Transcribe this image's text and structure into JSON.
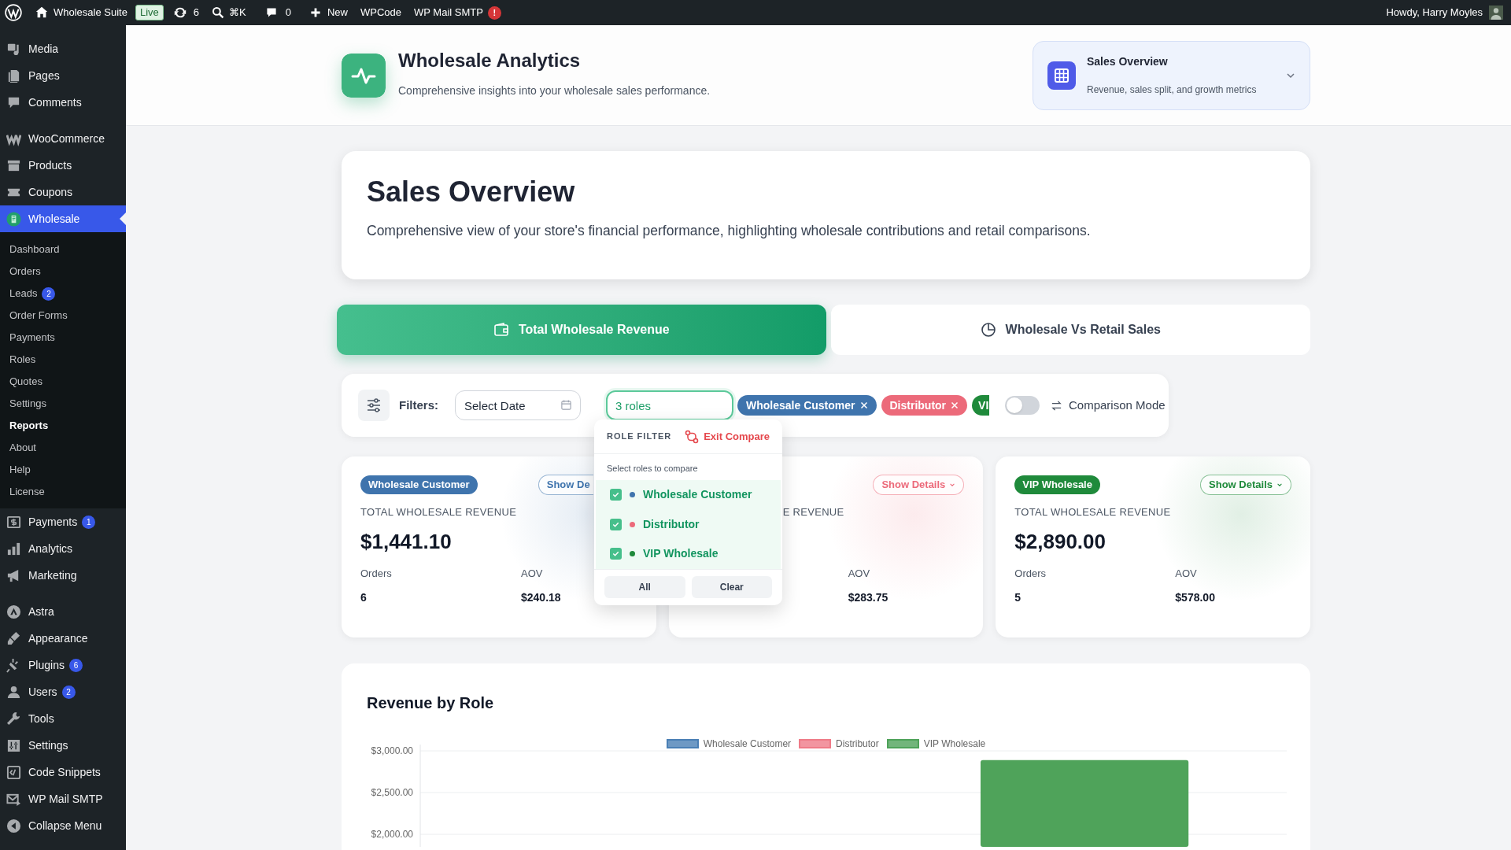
{
  "admin_bar": {
    "site": "Wholesale Suite",
    "live": "Live",
    "updates": "6",
    "search": "⌘K",
    "comments": "0",
    "new": "New",
    "links": [
      "WPCode",
      "WP Mail SMTP"
    ],
    "alert": "!",
    "greeting": "Howdy, Harry Moyles"
  },
  "sidebar": {
    "sections": [
      [
        {
          "label": "Media",
          "selected": false
        },
        {
          "label": "Pages",
          "selected": false
        },
        {
          "label": "Comments",
          "selected": false
        }
      ],
      [
        {
          "label": "WooCommerce",
          "selected": false
        },
        {
          "label": "Products",
          "selected": false
        },
        {
          "label": "Coupons",
          "selected": false
        },
        {
          "label": "Wholesale",
          "selected": true,
          "children": [
            {
              "label": "Dashboard",
              "selected": false
            },
            {
              "label": "Orders",
              "selected": false
            },
            {
              "label": "Leads",
              "selected": false,
              "badge": "2"
            },
            {
              "label": "Order Forms",
              "selected": false
            },
            {
              "label": "Payments",
              "selected": false
            },
            {
              "label": "Roles",
              "selected": false
            },
            {
              "label": "Quotes",
              "selected": false
            },
            {
              "label": "Settings",
              "selected": false
            },
            {
              "label": "Reports",
              "selected": true
            },
            {
              "label": "About",
              "selected": false
            },
            {
              "label": "Help",
              "selected": false
            },
            {
              "label": "License",
              "selected": false
            }
          ]
        },
        {
          "label": "Payments",
          "selected": false,
          "badge": "1"
        },
        {
          "label": "Analytics",
          "selected": false
        },
        {
          "label": "Marketing",
          "selected": false
        }
      ],
      [
        {
          "label": "Astra",
          "selected": false
        },
        {
          "label": "Appearance",
          "selected": false
        },
        {
          "label": "Plugins",
          "selected": false,
          "badge": "6"
        },
        {
          "label": "Users",
          "selected": false,
          "badge": "2"
        },
        {
          "label": "Tools",
          "selected": false
        },
        {
          "label": "Settings",
          "selected": false
        },
        {
          "label": "Code Snippets",
          "selected": false
        },
        {
          "label": "WP Mail SMTP",
          "selected": false
        },
        {
          "label": "Collapse Menu",
          "selected": false
        }
      ]
    ]
  },
  "header": {
    "title": "Wholesale Analytics",
    "subtitle": "Comprehensive insights into your wholesale sales performance.",
    "report_picker": {
      "title": "Sales Overview",
      "subtitle": "Revenue, sales split, and growth metrics"
    }
  },
  "overview": {
    "title": "Sales Overview",
    "description": "Comprehensive view of your store's financial performance, highlighting wholesale contributions and retail comparisons."
  },
  "tabs": [
    {
      "label": "Total Wholesale Revenue",
      "selected": true
    },
    {
      "label": "Wholesale Vs Retail Sales",
      "selected": false
    }
  ],
  "filters": {
    "label": "Filters:",
    "date_placeholder": "Select Date",
    "roles_value": "3 roles",
    "chips": [
      {
        "label": "Wholesale Customer",
        "color": "#3f74ad"
      },
      {
        "label": "Distributor",
        "color": "#ec6a7a"
      },
      {
        "label": "VI",
        "color": "#1f8a3b"
      }
    ],
    "comparison": {
      "label": "Comparison Mode",
      "on": false
    }
  },
  "role_menu": {
    "title": "ROLE FILTER",
    "exit": "Exit Compare",
    "hint": "Select roles to compare",
    "options": [
      {
        "label": "Wholesale Customer",
        "color": "#3f74ad",
        "checked": true
      },
      {
        "label": "Distributor",
        "color": "#ec6a7a",
        "checked": true
      },
      {
        "label": "VIP Wholesale",
        "color": "#1f8a3b",
        "checked": true
      }
    ],
    "buttons": [
      "All",
      "Clear"
    ]
  },
  "cards": [
    {
      "kind": "cut_right",
      "badge": "Wholesale Customer",
      "color": "#3f74ad",
      "details": "Show De",
      "revenue_label": "TOTAL WHOLESALE REVENUE",
      "revenue": "$1,441.10",
      "orders_label": "Orders",
      "orders": "6",
      "aov_label": "AOV",
      "aov": "$240.18"
    },
    {
      "kind": "cut_left",
      "color": "#ec6a7a",
      "details": "Show Details",
      "revenue_label": "E REVENUE",
      "aov_label": "AOV",
      "aov": "$283.75"
    },
    {
      "kind": "full",
      "badge": "VIP Wholesale",
      "color": "#1f8a3b",
      "details": "Show Details",
      "revenue_label": "TOTAL WHOLESALE REVENUE",
      "revenue": "$2,890.00",
      "orders_label": "Orders",
      "orders": "5",
      "aov_label": "AOV",
      "aov": "$578.00"
    }
  ],
  "chart": {
    "title": "Revenue by Role",
    "chart_data": {
      "type": "bar",
      "series": [
        {
          "name": "Wholesale Customer",
          "color": "#4a7fb5",
          "values": [
            null
          ]
        },
        {
          "name": "Distributor",
          "color": "#ef7b88",
          "values": [
            null
          ]
        },
        {
          "name": "VIP Wholesale",
          "color": "#4fa35a",
          "values": [
            2890
          ]
        }
      ],
      "ylim": [
        1850,
        3000
      ],
      "yticks": [
        {
          "value": 2000,
          "label": "$2,000.00"
        },
        {
          "value": 2500,
          "label": "$2,500.00"
        },
        {
          "value": 3000,
          "label": "$3,000.00"
        }
      ]
    }
  }
}
